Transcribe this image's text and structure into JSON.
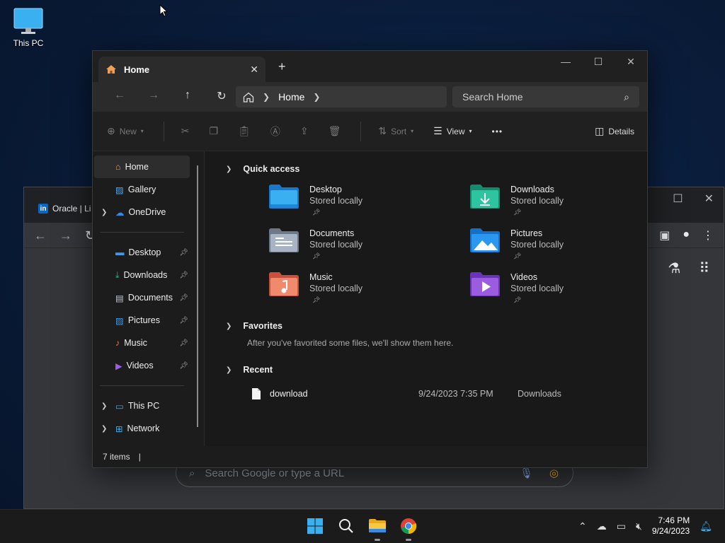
{
  "desktop": {
    "this_pc_label": "This PC"
  },
  "chrome": {
    "tab_title": "Oracle | Li",
    "search_placeholder": "Search Google or type a URL"
  },
  "explorer": {
    "tab_title": "Home",
    "new_tab": "+",
    "breadcrumb": {
      "current": "Home"
    },
    "search_placeholder": "Search Home",
    "commands": {
      "new": "New",
      "sort": "Sort",
      "view": "View",
      "more": "•••",
      "details": "Details"
    },
    "sidebar": {
      "top_items": [
        {
          "label": "Home",
          "icon": "home-icon"
        },
        {
          "label": "Gallery",
          "icon": "gallery-icon"
        },
        {
          "label": "OneDrive",
          "icon": "cloud-icon"
        }
      ],
      "pinned_items": [
        {
          "label": "Desktop",
          "icon": "desktop-folder-icon"
        },
        {
          "label": "Downloads",
          "icon": "downloads-icon"
        },
        {
          "label": "Documents",
          "icon": "documents-icon"
        },
        {
          "label": "Pictures",
          "icon": "pictures-icon"
        },
        {
          "label": "Music",
          "icon": "music-icon"
        },
        {
          "label": "Videos",
          "icon": "videos-icon"
        }
      ],
      "bottom_items": [
        {
          "label": "This PC",
          "icon": "pc-icon"
        },
        {
          "label": "Network",
          "icon": "network-icon"
        }
      ]
    },
    "quick_access": {
      "title": "Quick access",
      "items": [
        {
          "name": "Desktop",
          "sub": "Stored locally",
          "color": "#3d9be9"
        },
        {
          "name": "Downloads",
          "sub": "Stored locally",
          "color": "#26a88a"
        },
        {
          "name": "Documents",
          "sub": "Stored locally",
          "color": "#8a97aa"
        },
        {
          "name": "Pictures",
          "sub": "Stored locally",
          "color": "#1e90e8"
        },
        {
          "name": "Music",
          "sub": "Stored locally",
          "color": "#e8705a"
        },
        {
          "name": "Videos",
          "sub": "Stored locally",
          "color": "#8b4fd6"
        }
      ]
    },
    "favorites": {
      "title": "Favorites",
      "message": "After you've favorited some files, we'll show them here."
    },
    "recent": {
      "title": "Recent",
      "items": [
        {
          "name": "download",
          "date": "9/24/2023 7:35 PM",
          "location": "Downloads"
        }
      ]
    },
    "status": {
      "count": "7 items"
    }
  },
  "taskbar": {
    "time": "7:46 PM",
    "date": "9/24/2023"
  }
}
